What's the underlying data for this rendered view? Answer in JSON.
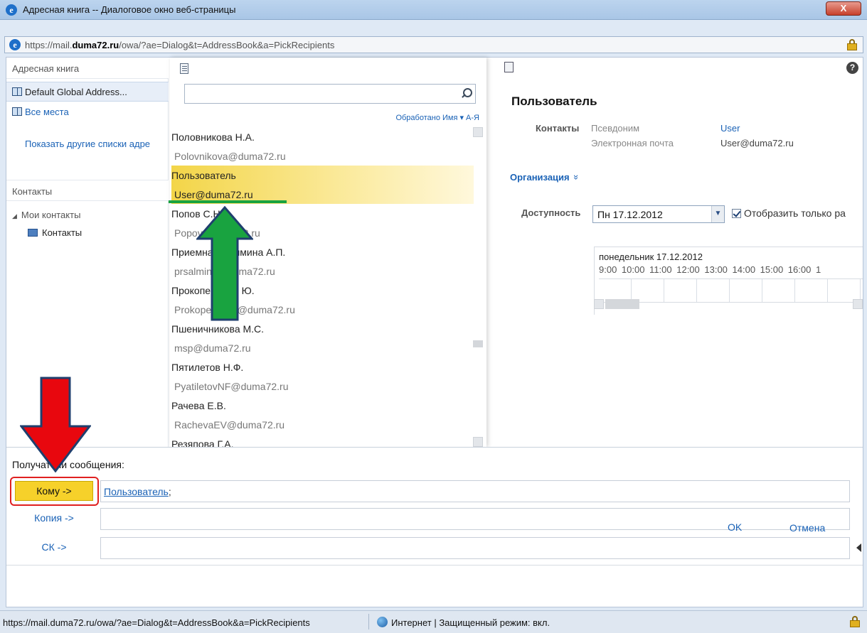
{
  "window": {
    "title": "Адресная книга -- Диалоговое окно веб-страницы",
    "close_label": "X",
    "url_prefix": "https://mail.",
    "url_domain": "duma72.ru",
    "url_path": "/owa/?ae=Dialog&t=AddressBook&a=PickRecipients"
  },
  "left_panel": {
    "address_book_header": "Адресная книга",
    "items": [
      {
        "label": "Default Global Address..."
      },
      {
        "label": "Все места"
      }
    ],
    "show_other_lists": "Показать другие списки адре",
    "contacts_header": "Контакты",
    "my_contacts": "Мои контакты",
    "contacts_folder": "Контакты"
  },
  "list": {
    "search_placeholder": "",
    "sort_label": "Обработано Имя ▾   А-Я",
    "rows": [
      {
        "name": "Половникова Н.А.",
        "email": "Polovnikova@duma72.ru"
      },
      {
        "name": "Пользователь",
        "email": "User@duma72.ru",
        "selected": true
      },
      {
        "name": "Попов С.Н.",
        "email": "Popov@duma72.ru"
      },
      {
        "name": "Приемная Салмина А.П.",
        "email": "prsalmina@duma72.ru"
      },
      {
        "name": "Прокопенко И. Ю.",
        "email": "ProkopenkoIU@duma72.ru"
      },
      {
        "name": "Пшеничникова М.С.",
        "email": "msp@duma72.ru"
      },
      {
        "name": "Пятилетов Н.Ф.",
        "email": "PyatiletovNF@duma72.ru"
      },
      {
        "name": "Рачева Е.В.",
        "email": "RachevaEV@duma72.ru"
      },
      {
        "name": "Резяпова Г.А.",
        "email": ""
      }
    ]
  },
  "details": {
    "title": "Пользователь",
    "contacts_label": "Контакты",
    "alias_label": "Псевдоним",
    "alias_value": "User",
    "email_label": "Электронная почта",
    "email_value": "User@duma72.ru",
    "organization_label": "Организация",
    "organization_chevron": "»",
    "availability_label": "Доступность",
    "date_value": "Пн 17.12.2012",
    "show_only_label": "Отобразить только ра",
    "schedule_day": "понедельник 17.12.2012",
    "schedule_hours": "9:00  10:00 11:00 12:00 13:00 14:00 15:00 16:00 1"
  },
  "recipients": {
    "title": "Получатели сообщения:",
    "to_button": "Кому ->",
    "to_value": "Пользователь",
    "to_suffix": ";",
    "cc_button": "Копия ->",
    "bcc_button": "СК ->"
  },
  "actions": {
    "ok": "OK",
    "cancel": "Отмена"
  },
  "status_bar": {
    "url": "https://mail.duma72.ru/owa/?ae=Dialog&t=AddressBook&a=PickRecipients",
    "zone": "Интернет | Защищенный режим: вкл."
  },
  "colors": {
    "accent": "#1a62b6",
    "selection": "#f3d548",
    "to_button": "#f6d12a",
    "arrow_green": "#19a340",
    "arrow_red": "#e8070e"
  }
}
